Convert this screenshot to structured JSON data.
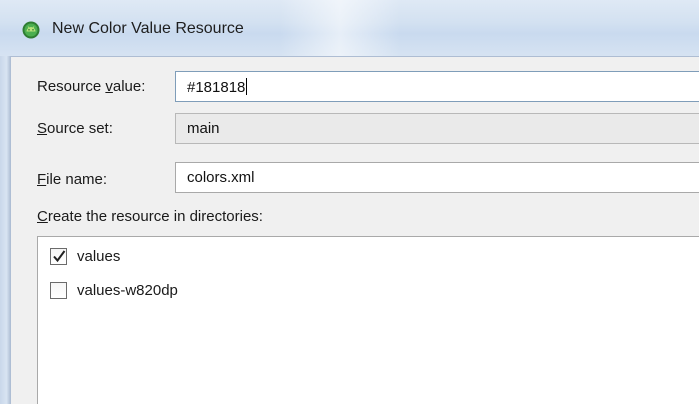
{
  "window": {
    "title": "New Color Value Resource",
    "icon": "android-studio-icon"
  },
  "form": {
    "resource_value": {
      "label_prefix": "Resource ",
      "label_accel": "v",
      "label_suffix": "alue:",
      "value": "#181818"
    },
    "source_set": {
      "label_accel": "S",
      "label_suffix": "ource set:",
      "value": "main"
    },
    "file_name": {
      "label_accel": "F",
      "label_suffix": "ile name:",
      "value": "colors.xml"
    },
    "directories": {
      "label_accel": "C",
      "label_suffix": "reate the resource in directories:",
      "items": [
        {
          "label": "values",
          "checked": true,
          "check_mark": "✓"
        },
        {
          "label": "values-w820dp",
          "checked": false,
          "check_mark": ""
        }
      ]
    }
  },
  "colors": {
    "titlebar": "#d3e1f1",
    "dialog_bg": "#f0f0f0",
    "field_border": "#a9a9a9"
  }
}
